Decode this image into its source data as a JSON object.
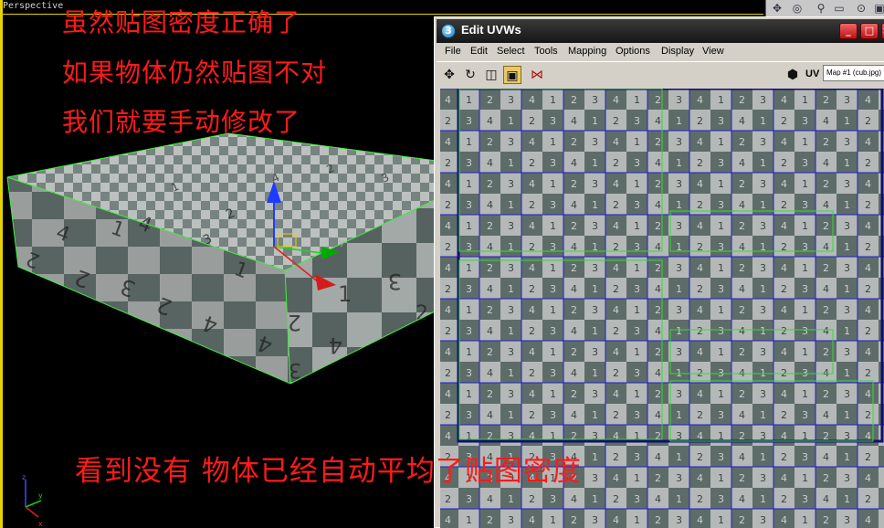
{
  "viewport": {
    "label": "Perspective",
    "captions": [
      "虽然贴图密度正确了",
      "如果物体仍然贴图不对",
      "我们就要手动修改了",
      "看到没有   物体已经自动平均了贴图密度"
    ],
    "axes": {
      "x": "x",
      "y": "y",
      "z": "z"
    }
  },
  "uvw_window": {
    "title": "Edit UVWs",
    "controls": {
      "minimize": "_",
      "maximize": "□",
      "close": "×"
    },
    "menu": [
      "File",
      "Edit",
      "Select",
      "Tools",
      "Mapping",
      "Options",
      "Display",
      "View"
    ],
    "toolbar": {
      "tools": [
        "move-icon",
        "rotate-icon",
        "scale-icon",
        "freeform-icon",
        "mirror-icon"
      ],
      "uv_label": "UV",
      "map_select": "Map #1 (cub.jpg)"
    },
    "checker_digits": [
      "4",
      "1",
      "2",
      "3"
    ],
    "colors": {
      "checker_dark": "#5e6c69",
      "checker_light": "#b4b9b7",
      "grid": "#2020c8",
      "selection": "#34dc34"
    }
  }
}
